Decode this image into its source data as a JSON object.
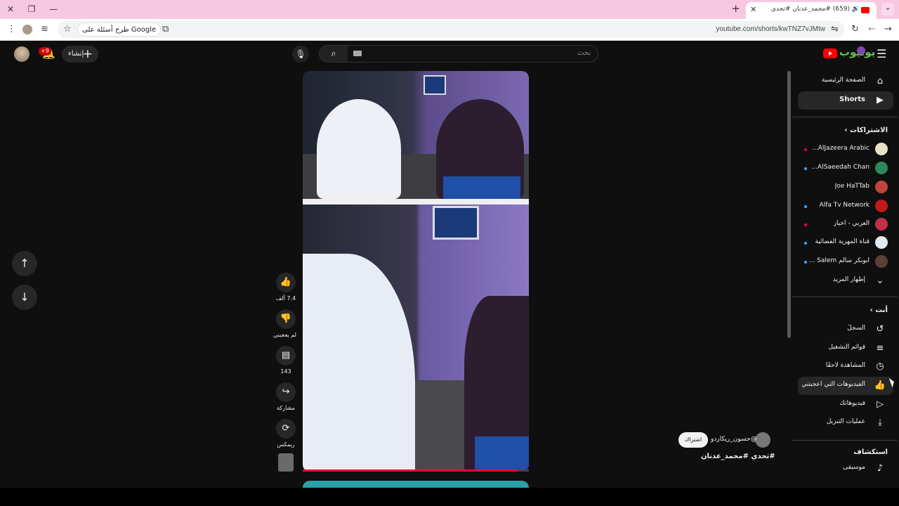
{
  "browser": {
    "tab_title": "(659) #محمد_عدنان #تحدي",
    "url": "youtube.com/shorts/kwTNZ7vJMtw",
    "google_ask": "طرح أسئلة على Google"
  },
  "header": {
    "notification_count": "+9",
    "create_label": "إنشاء",
    "search_placeholder": "بحث"
  },
  "sidebar": {
    "main": [
      {
        "label": "الصفحة الرئيسية",
        "icon": "home-icon"
      },
      {
        "label": "Shorts",
        "icon": "shorts-icon",
        "active": true
      }
    ],
    "subscriptions_header": "الاشتراكات",
    "subscriptions": [
      {
        "label": "AlJazeera Arabic...",
        "color": "#e8e0c8",
        "live": true
      },
      {
        "label": "AlSaeedah Chan...",
        "color": "#2c8a5a",
        "live": true
      },
      {
        "label": "Joe HaTTab",
        "color": "#c0443c",
        "live": false
      },
      {
        "label": "Alfa Tv Network",
        "color": "#c01a1a",
        "live": true
      },
      {
        "label": "العربي - أخبار",
        "color": "#c0304a",
        "live": true
      },
      {
        "label": "قناة المهرية الفضائية",
        "color": "#e0e8f0",
        "live": true
      },
      {
        "label": "أبوبكر سالم Salem ...",
        "color": "#5a4038",
        "live": true
      }
    ],
    "show_more": "إظهار المزيد",
    "you_header": "أنت",
    "you": [
      {
        "label": "السجلّ",
        "icon": "history-icon"
      },
      {
        "label": "قوائم التشغيل",
        "icon": "playlists-icon"
      },
      {
        "label": "المشاهدة لاحقًا",
        "icon": "watch-later-icon"
      },
      {
        "label": "الفيديوهات التي أعجبتني",
        "icon": "liked-icon",
        "hover": true
      },
      {
        "label": "فيديوهاتك",
        "icon": "your-videos-icon"
      },
      {
        "label": "عمليات التنزيل",
        "icon": "downloads-icon"
      }
    ],
    "explore_header": "استكشاف",
    "explore": [
      {
        "label": "موسيقى",
        "icon": "music-icon"
      }
    ]
  },
  "actions": {
    "likes": "7.4 ألف",
    "dislike": "لم يعجبني",
    "comments": "143",
    "share": "مشاركة",
    "remix": "ريمكس"
  },
  "video": {
    "channel": "@حسون_ريكاردو",
    "subscribe": "اشتراك",
    "title": "#تحدي #محمد_عدنان",
    "progress": 0.95
  },
  "colors": {
    "accent_red": "#ff0033",
    "background": "#0f0f0f",
    "tab_strip": "#f7c9e0"
  }
}
